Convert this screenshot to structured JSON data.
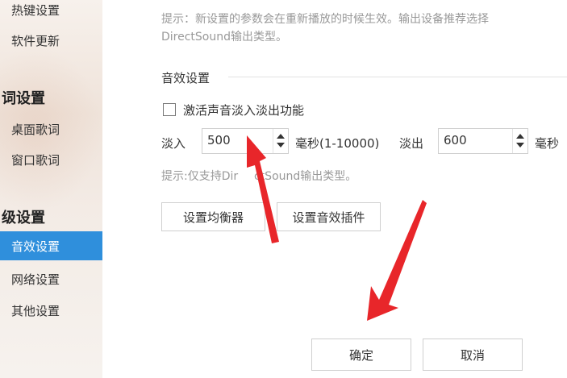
{
  "sidebar": {
    "items_top": [
      {
        "label": "热键设置"
      },
      {
        "label": "软件更新"
      }
    ],
    "section_lyrics": {
      "title": "词设置"
    },
    "lyrics_items": [
      {
        "label": "桌面歌词"
      },
      {
        "label": "窗口歌词"
      }
    ],
    "section_advanced": {
      "title": "级设置"
    },
    "advanced_items": [
      {
        "label": "音效设置",
        "active": true
      },
      {
        "label": "网络设置"
      },
      {
        "label": "其他设置"
      }
    ]
  },
  "main": {
    "hint_top_line1": "提示：新设置的参数会在重新播放的时候生效。输出设备推荐选择",
    "hint_top_line2": "DirectSound输出类型。",
    "sound_section_title": "音效设置",
    "fade_checkbox_label": "激活声音淡入淡出功能",
    "fade_checkbox_checked": false,
    "fade_in_label": "淡入",
    "fade_in_value": "500",
    "fade_in_unit": "毫秒(1-10000)",
    "fade_out_label": "淡出",
    "fade_out_value": "600",
    "fade_out_unit": "毫秒",
    "hint_bottom_a": "提示:仅支持Dir",
    "hint_bottom_b": "ctSound输出类型。",
    "equalizer_button": "设置均衡器",
    "plugin_button": "设置音效插件",
    "ok_button": "确定",
    "cancel_button": "取消"
  },
  "colors": {
    "accent": "#2f8fdc",
    "arrow": "#e8262a"
  }
}
